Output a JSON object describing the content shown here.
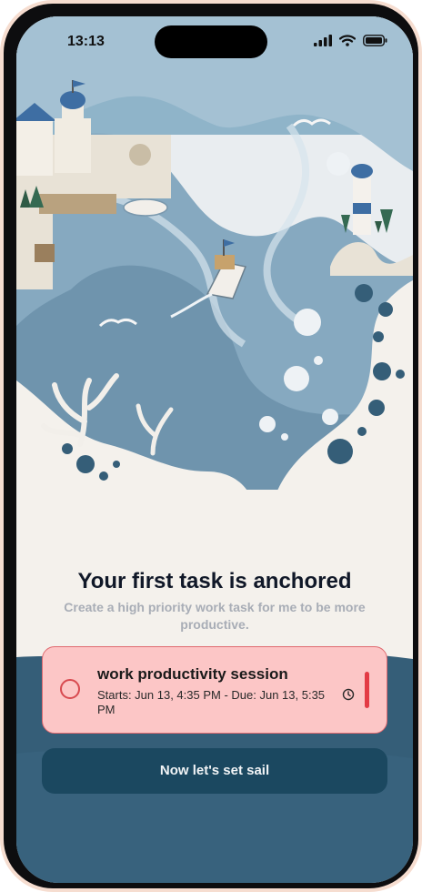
{
  "status_bar": {
    "time": "13:13",
    "icons": [
      "cellular-signal-icon",
      "wifi-icon",
      "battery-icon"
    ]
  },
  "hero": {
    "illustration": "paper-art harbor with lighthouses, boat, coral and bubbles"
  },
  "onboarding": {
    "title": "Your first task is anchored",
    "subtitle": "Create a high priority work task for me to be more productive."
  },
  "task": {
    "title": "work productivity session",
    "schedule": "Starts: Jun 13, 4:35 PM - Due: Jun 13, 5:35 PM",
    "priority": "high",
    "completed": false
  },
  "cta": {
    "label": "Now let's set sail"
  },
  "colors": {
    "background": "#f4f1ec",
    "sea": "#355e78",
    "card_fill": "#fcc6c6",
    "card_border": "#e06a70",
    "priority": "#e33b45",
    "button": "#1b4860"
  }
}
